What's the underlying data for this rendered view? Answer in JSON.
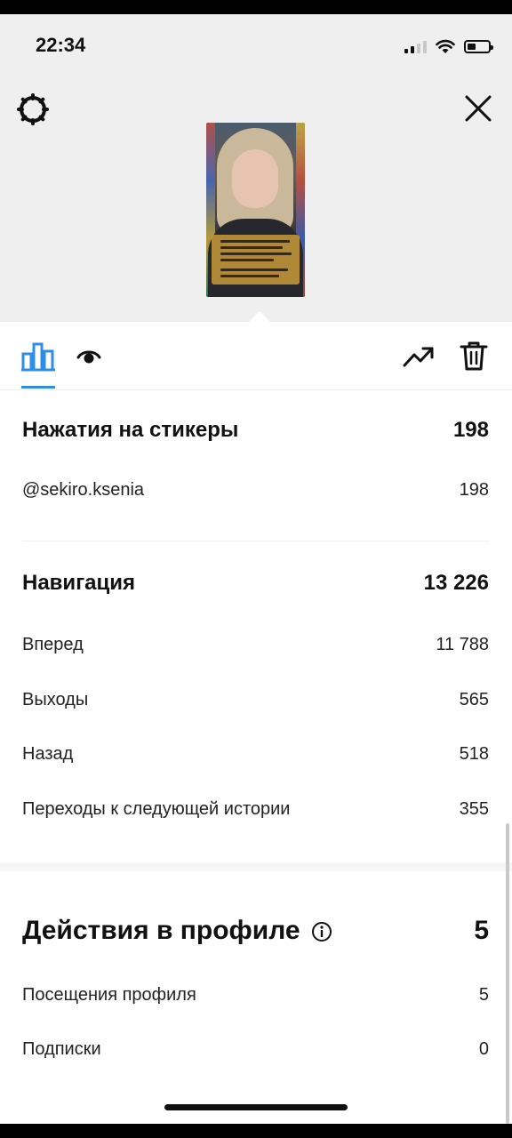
{
  "status_bar": {
    "time": "22:34",
    "battery_level": 0.4
  },
  "top": {
    "settings_icon": "settings-gear-icon",
    "close_icon": "close-icon",
    "thumbnail": "story-thumbnail"
  },
  "tabs": {
    "stats_icon": "bar-chart-icon",
    "viewers_icon": "eye-icon",
    "promote_icon": "trending-up-icon",
    "delete_icon": "trash-icon",
    "active_color": "#2f8de4"
  },
  "stickers": {
    "title": "Нажатия на стикеры",
    "total": "198",
    "items": [
      {
        "label": "@sekiro.ksenia",
        "value": "198"
      }
    ]
  },
  "navigation": {
    "title": "Навигация",
    "total": "13 226",
    "items": [
      {
        "label": "Вперед",
        "value": "11 788"
      },
      {
        "label": "Выходы",
        "value": "565"
      },
      {
        "label": "Назад",
        "value": "518"
      },
      {
        "label": "Переходы к следующей истории",
        "value": "355"
      }
    ]
  },
  "profile_actions": {
    "title": "Действия в профиле",
    "total": "5",
    "info_icon": "info-icon",
    "items": [
      {
        "label": "Посещения профиля",
        "value": "5"
      },
      {
        "label": "Подписки",
        "value": "0"
      }
    ]
  }
}
